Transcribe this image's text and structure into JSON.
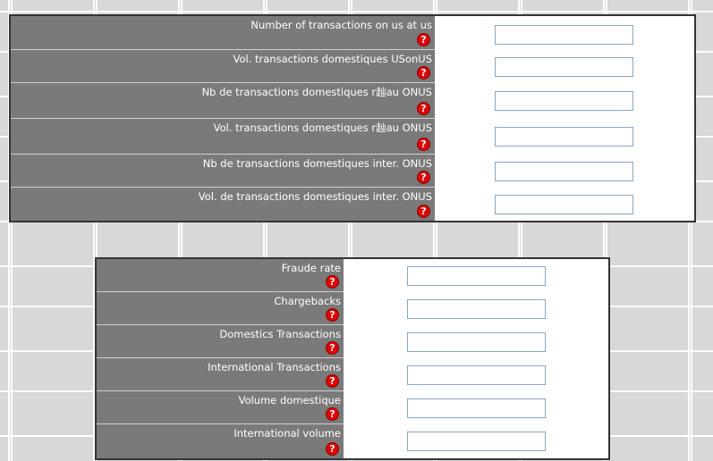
{
  "help_glyph": "?",
  "help_icon_color": "#e00000",
  "panel_1": {
    "rows": [
      {
        "label": "Number of transactions on us at us",
        "value": ""
      },
      {
        "label": "Vol. transactions domestiques USonUS",
        "value": ""
      },
      {
        "label": "Nb de transactions domestiques r赸au ONUS",
        "value": ""
      },
      {
        "label": "Vol. transactions domestiques r赸au ONUS",
        "value": ""
      },
      {
        "label": "Nb de transactions domestiques inter. ONUS",
        "value": ""
      },
      {
        "label": "Vol. de transactions domestiques inter. ONUS",
        "value": ""
      }
    ]
  },
  "panel_2": {
    "rows": [
      {
        "label": "Fraude rate",
        "value": ""
      },
      {
        "label": "Chargebacks",
        "value": ""
      },
      {
        "label": "Domestics Transactions",
        "value": ""
      },
      {
        "label": "International Transactions",
        "value": ""
      },
      {
        "label": "Volume domestique",
        "value": ""
      },
      {
        "label": "International volume",
        "value": ""
      }
    ]
  }
}
